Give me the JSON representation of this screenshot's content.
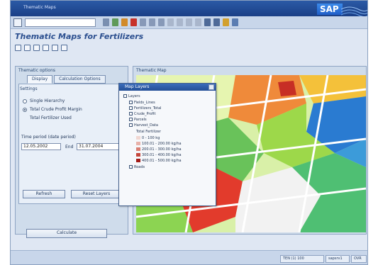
{
  "window": {
    "title": "Thematic Maps"
  },
  "branding": {
    "logo": "SAP",
    "logo_color": "#2d73d6"
  },
  "toolbar": {
    "command_field": "",
    "icons": [
      "enter-icon",
      "save-icon",
      "back-icon",
      "exit-icon",
      "cancel-icon",
      "print-icon",
      "find-icon",
      "find-next-icon",
      "first-page-icon",
      "prev-page-icon",
      "next-page-icon",
      "last-page-icon",
      "new-session-icon",
      "shortcut-icon",
      "help-icon",
      "settings-icon"
    ]
  },
  "page": {
    "title": "Thematic Maps for Fertilizers"
  },
  "left_panel": {
    "title": "Thematic options",
    "tabs": [
      "Display",
      "Calculation Options"
    ],
    "settings_title": "Settings",
    "option_1": "Single Hierarchy",
    "option_2": "Total Crude Profit Margin",
    "option_3": "Total Fertilizer Used",
    "period_label": "Time period (date period)",
    "date_from": "12.05.2002",
    "date_to_label": "End",
    "date_to": "31.07.2004",
    "button_left": "Refresh",
    "button_right": "Reset Layers"
  },
  "map_panel": {
    "title": "Thematic Map"
  },
  "layer_popup": {
    "title": "Map Layers",
    "root": "Layers",
    "items": [
      "Fields_Lines",
      "Fertilizers_Total",
      "Crude_Profit",
      "Parcels",
      "Harvest_Data"
    ],
    "legend_title": "Total Fertilizer",
    "legend": [
      {
        "label": "0 - 100 kg",
        "color": "#f1d7d2"
      },
      {
        "label": "100.01 - 200.00 kg/ha",
        "color": "#e8b2aa"
      },
      {
        "label": "200.01 - 300.00 kg/ha",
        "color": "#d97e73"
      },
      {
        "label": "300.01 - 400.00 kg/ha",
        "color": "#c5463b"
      },
      {
        "label": "400.01 - 500.00 kg/ha",
        "color": "#a31b17"
      }
    ],
    "footer_item": "Roads"
  },
  "bottom": {
    "execute_button": "Calculate"
  },
  "status_bar": {
    "system": "TEN (1) 100",
    "server": "sapsrv1",
    "mode": "OVR"
  }
}
